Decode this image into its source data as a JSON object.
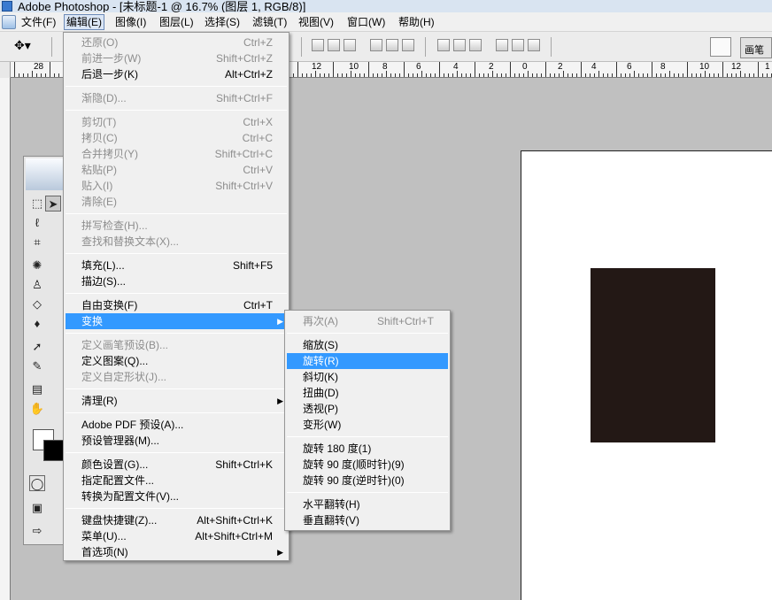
{
  "window": {
    "title": "Adobe Photoshop - [未标题-1 @ 16.7% (图层 1, RGB/8)]"
  },
  "menubar": [
    {
      "label": "文件(F)"
    },
    {
      "label": "编辑(E)"
    },
    {
      "label": "图像(I)"
    },
    {
      "label": "图层(L)"
    },
    {
      "label": "选择(S)"
    },
    {
      "label": "滤镜(T)"
    },
    {
      "label": "视图(V)"
    },
    {
      "label": "窗口(W)"
    },
    {
      "label": "帮助(H)"
    }
  ],
  "options_bar": {
    "brush_tab": "画笔"
  },
  "ruler": [
    "28",
    "12",
    "10",
    "8",
    "6",
    "4",
    "2",
    "0",
    "2",
    "4",
    "6",
    "8",
    "10",
    "12",
    "1"
  ],
  "edit_menu": [
    {
      "label": "还原(O)",
      "shortcut": "Ctrl+Z",
      "disabled": true
    },
    {
      "label": "前进一步(W)",
      "shortcut": "Shift+Ctrl+Z",
      "disabled": true
    },
    {
      "label": "后退一步(K)",
      "shortcut": "Alt+Ctrl+Z",
      "disabled": false
    },
    {
      "label": "渐隐(D)...",
      "shortcut": "Shift+Ctrl+F",
      "disabled": true
    },
    {
      "label": "剪切(T)",
      "shortcut": "Ctrl+X",
      "disabled": true
    },
    {
      "label": "拷贝(C)",
      "shortcut": "Ctrl+C",
      "disabled": true
    },
    {
      "label": "合并拷贝(Y)",
      "shortcut": "Shift+Ctrl+C",
      "disabled": true
    },
    {
      "label": "粘贴(P)",
      "shortcut": "Ctrl+V",
      "disabled": true
    },
    {
      "label": "贴入(I)",
      "shortcut": "Shift+Ctrl+V",
      "disabled": true
    },
    {
      "label": "清除(E)",
      "shortcut": "",
      "disabled": true
    },
    {
      "label": "拼写检查(H)...",
      "shortcut": "",
      "disabled": true
    },
    {
      "label": "查找和替换文本(X)...",
      "shortcut": "",
      "disabled": true
    },
    {
      "label": "填充(L)...",
      "shortcut": "Shift+F5",
      "disabled": false
    },
    {
      "label": "描边(S)...",
      "shortcut": "",
      "disabled": false
    },
    {
      "label": "自由变换(F)",
      "shortcut": "Ctrl+T",
      "disabled": false
    },
    {
      "label": "变换",
      "shortcut": "",
      "disabled": false,
      "highlighted": true,
      "submenu": true
    },
    {
      "label": "定义画笔预设(B)...",
      "shortcut": "",
      "disabled": true
    },
    {
      "label": "定义图案(Q)...",
      "shortcut": "",
      "disabled": false
    },
    {
      "label": "定义自定形状(J)...",
      "shortcut": "",
      "disabled": true
    },
    {
      "label": "清理(R)",
      "shortcut": "",
      "disabled": false,
      "submenu": true
    },
    {
      "label": "Adobe PDF 预设(A)...",
      "shortcut": "",
      "disabled": false
    },
    {
      "label": "预设管理器(M)...",
      "shortcut": "",
      "disabled": false
    },
    {
      "label": "颜色设置(G)...",
      "shortcut": "Shift+Ctrl+K",
      "disabled": false
    },
    {
      "label": "指定配置文件...",
      "shortcut": "",
      "disabled": false
    },
    {
      "label": "转换为配置文件(V)...",
      "shortcut": "",
      "disabled": false
    },
    {
      "label": "键盘快捷键(Z)...",
      "shortcut": "Alt+Shift+Ctrl+K",
      "disabled": false
    },
    {
      "label": "菜单(U)...",
      "shortcut": "Alt+Shift+Ctrl+M",
      "disabled": false
    },
    {
      "label": "首选项(N)",
      "shortcut": "",
      "disabled": false,
      "submenu": true
    }
  ],
  "transform_menu": [
    {
      "label": "再次(A)",
      "shortcut": "Shift+Ctrl+T",
      "disabled": true
    },
    {
      "label": "缩放(S)",
      "shortcut": "",
      "disabled": false
    },
    {
      "label": "旋转(R)",
      "shortcut": "",
      "disabled": false,
      "highlighted": true
    },
    {
      "label": "斜切(K)",
      "shortcut": "",
      "disabled": false
    },
    {
      "label": "扭曲(D)",
      "shortcut": "",
      "disabled": false
    },
    {
      "label": "透视(P)",
      "shortcut": "",
      "disabled": false
    },
    {
      "label": "变形(W)",
      "shortcut": "",
      "disabled": false
    },
    {
      "label": "旋转 180 度(1)",
      "shortcut": "",
      "disabled": false
    },
    {
      "label": "旋转 90 度(顺时针)(9)",
      "shortcut": "",
      "disabled": false
    },
    {
      "label": "旋转 90 度(逆时针)(0)",
      "shortcut": "",
      "disabled": false
    },
    {
      "label": "水平翻转(H)",
      "shortcut": "",
      "disabled": false
    },
    {
      "label": "垂直翻转(V)",
      "shortcut": "",
      "disabled": false
    }
  ],
  "colors": {
    "highlight": "#3399ff",
    "layer_fill": "#231815",
    "canvas_bg": "#c0c0c0",
    "document_bg": "#ffffff"
  }
}
